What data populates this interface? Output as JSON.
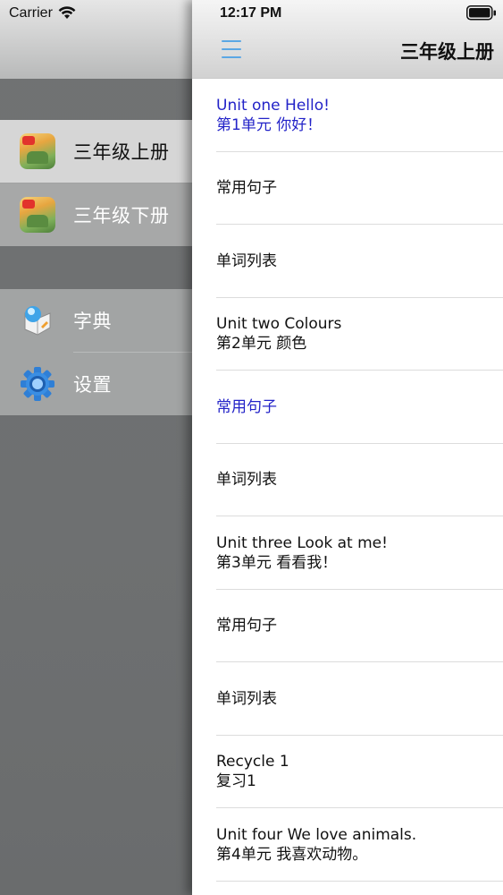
{
  "status_bar": {
    "carrier": "Carrier",
    "time": "12:17 PM"
  },
  "header": {
    "title": "三年级上册"
  },
  "drawer": {
    "books": [
      {
        "label": "三年级上册",
        "icon": "book-cover-icon",
        "selected": true
      },
      {
        "label": "三年级下册",
        "icon": "book-cover-icon",
        "selected": false
      }
    ],
    "tools": [
      {
        "label": "字典",
        "icon": "dictionary-icon"
      },
      {
        "label": "设置",
        "icon": "gear-icon"
      }
    ]
  },
  "list": [
    {
      "line1": "Unit one Hello!",
      "line2": "第1单元 你好！",
      "selected": true
    },
    {
      "line1": "常用句子",
      "line2": "",
      "selected": false
    },
    {
      "line1": "单词列表",
      "line2": "",
      "selected": false
    },
    {
      "line1": "Unit two Colours",
      "line2": "第2单元 颜色",
      "selected": false
    },
    {
      "line1": "常用句子",
      "line2": "",
      "selected": true
    },
    {
      "line1": "单词列表",
      "line2": "",
      "selected": false
    },
    {
      "line1": "Unit three Look at me!",
      "line2": "第3单元 看看我！",
      "selected": false
    },
    {
      "line1": "常用句子",
      "line2": "",
      "selected": false
    },
    {
      "line1": "单词列表",
      "line2": "",
      "selected": false
    },
    {
      "line1": "Recycle 1",
      "line2": "复习1",
      "selected": false
    },
    {
      "line1": "Unit four We love animals.",
      "line2": "第4单元 我喜欢动物。",
      "selected": false
    }
  ],
  "colors": {
    "accent_blue": "#5ba7e4",
    "selected_text": "#2323c8",
    "drawer_bg": "#6f7172"
  }
}
